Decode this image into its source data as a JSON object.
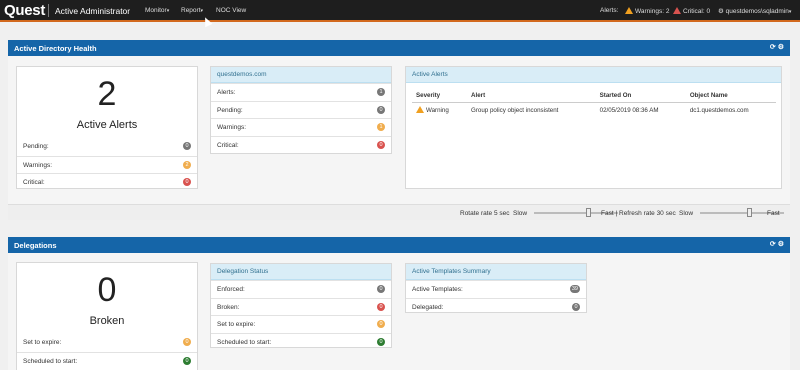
{
  "topbar": {
    "brand": "Quest",
    "app_title": "Active Administrator",
    "nav": [
      {
        "label": "Monitor",
        "caret": "▾"
      },
      {
        "label": "Report",
        "caret": "▾"
      },
      {
        "label": "NOC View",
        "caret": ""
      }
    ],
    "alerts_label": "Alerts:",
    "warnings": "Warnings: 2",
    "critical": "Critical: 0",
    "user": "questdemos\\sqladmin",
    "user_caret": "▾",
    "colors": {
      "accent": "#d2691e",
      "warning": "#f0a020",
      "critical": "#d9534f"
    }
  },
  "ad_health": {
    "title": "Active Directory Health",
    "tools": "⟳ ⚙",
    "summary": {
      "count": "2",
      "label": "Active Alerts",
      "rows": [
        {
          "label": "Pending:",
          "value": "0",
          "color": "#777777"
        },
        {
          "label": "Warnings:",
          "value": "2",
          "color": "#f0ad4e"
        },
        {
          "label": "Critical:",
          "value": "0",
          "color": "#d9534f"
        }
      ]
    },
    "domain": {
      "title": "questdemos.com",
      "rows": [
        {
          "label": "Alerts:",
          "value": "1",
          "color": "#777777"
        },
        {
          "label": "Pending:",
          "value": "0",
          "color": "#777777"
        },
        {
          "label": "Warnings:",
          "value": "1",
          "color": "#f0ad4e"
        },
        {
          "label": "Critical:",
          "value": "0",
          "color": "#d9534f"
        }
      ]
    },
    "active_alerts": {
      "title": "Active Alerts",
      "columns": [
        "Severity",
        "Alert",
        "Started On",
        "Object Name"
      ],
      "rows": [
        {
          "severity": "Warning",
          "alert": "Group policy object inconsistent",
          "started": "02/05/2019 08:36 AM",
          "object": "dc1.questdemos.com"
        }
      ]
    },
    "footer": {
      "rotate_label": "Rotate rate 5 sec",
      "slow1": "Slow",
      "fast1": "Fast |",
      "refresh_label": "Refresh rate 30 sec",
      "slow2": "Slow",
      "fast2": "Fast"
    }
  },
  "delegations": {
    "title": "Delegations",
    "tools": "⟳ ⚙",
    "summary": {
      "count": "0",
      "label": "Broken",
      "rows": [
        {
          "label": "Set to expire:",
          "value": "0",
          "color": "#f0ad4e"
        },
        {
          "label": "Scheduled to start:",
          "value": "0",
          "color": "#2e7d32"
        }
      ]
    },
    "status": {
      "title": "Delegation Status",
      "rows": [
        {
          "label": "Enforced:",
          "value": "0",
          "color": "#777777"
        },
        {
          "label": "Broken:",
          "value": "0",
          "color": "#d9534f"
        },
        {
          "label": "Set to expire:",
          "value": "0",
          "color": "#f0ad4e"
        },
        {
          "label": "Scheduled to start:",
          "value": "0",
          "color": "#2e7d32"
        }
      ]
    },
    "templates": {
      "title": "Active Templates Summary",
      "rows": [
        {
          "label": "Active Templates:",
          "value": "39",
          "color": "#777777"
        },
        {
          "label": "Delegated:",
          "value": "0",
          "color": "#777777"
        }
      ]
    }
  }
}
